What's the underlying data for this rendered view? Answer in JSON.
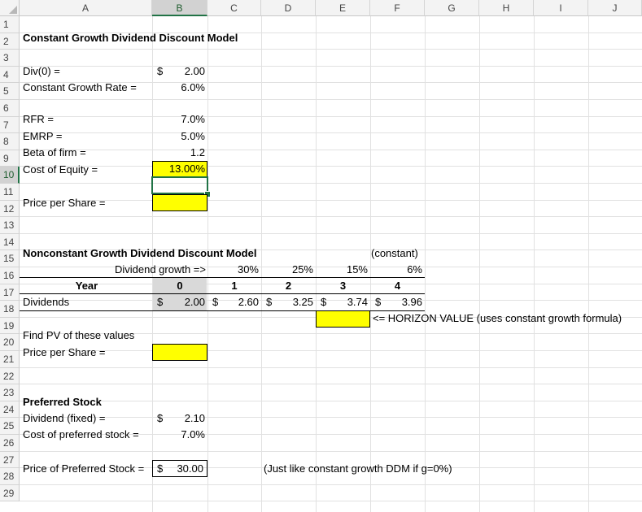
{
  "columns": [
    "A",
    "B",
    "C",
    "D",
    "E",
    "F",
    "G",
    "H",
    "I",
    "J"
  ],
  "selected_column": "B",
  "rows": [
    "1",
    "2",
    "3",
    "4",
    "5",
    "6",
    "7",
    "8",
    "9",
    "10",
    "11",
    "12",
    "13",
    "14",
    "15",
    "16",
    "17",
    "18",
    "19",
    "20",
    "21",
    "22",
    "23",
    "24",
    "25",
    "26",
    "27",
    "28",
    "29"
  ],
  "selected_row": "10",
  "sheet": {
    "title": "Constant Growth Dividend Discount Model",
    "div0_label": "Div(0) =",
    "div0_currency": "$",
    "div0_value": "2.00",
    "growth_label": "Constant Growth Rate =",
    "growth_value": "6.0%",
    "rfr_label": "RFR =",
    "rfr_value": "7.0%",
    "emrp_label": "EMRP =",
    "emrp_value": "5.0%",
    "beta_label": "Beta of firm =",
    "beta_value": "1.2",
    "coe_label": "Cost of Equity =",
    "coe_value": "13.00%",
    "price_label": "Price per Share =",
    "nc_title": "Nonconstant Growth Dividend Discount Model",
    "constant_note": "(constant)",
    "growth_row_label": "Dividend growth =>",
    "growth_rates": [
      "30%",
      "25%",
      "15%",
      "6%"
    ],
    "year_label": "Year",
    "years": [
      "0",
      "1",
      "2",
      "3",
      "4"
    ],
    "dividends_label": "Dividends",
    "dividends": [
      "2.00",
      "2.60",
      "3.25",
      "3.74",
      "3.96"
    ],
    "currency": "$",
    "horizon_note": "<= HORIZON VALUE (uses constant growth formula)",
    "find_pv_label": "Find PV of these values",
    "price_label_2": "Price per Share =",
    "pref_title": "Preferred Stock",
    "pref_div_label": "Dividend (fixed) =",
    "pref_div_value": "2.10",
    "pref_cost_label": "Cost of preferred stock =",
    "pref_cost_value": "7.0%",
    "pref_price_label": "Price of Preferred Stock =",
    "pref_price_value": "30.00",
    "pref_note": "(Just like constant growth DDM if g=0%)"
  },
  "colors": {
    "highlight": "#ffff00",
    "selection": "#217346"
  }
}
